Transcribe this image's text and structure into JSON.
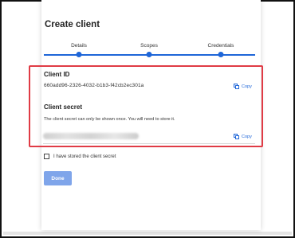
{
  "dialog": {
    "title": "Create client",
    "steps": [
      {
        "label": "Details"
      },
      {
        "label": "Scopes"
      },
      {
        "label": "Credentials"
      }
    ],
    "client_id": {
      "label": "Client ID",
      "value": "660add96-2326-4032-b1b3-f42cb2ec301a",
      "copy_label": "Copy"
    },
    "client_secret": {
      "label": "Client secret",
      "note": "The client secret can only be shown once. You will need to store it.",
      "copy_label": "Copy"
    },
    "stored_checkbox": {
      "label": "I have stored the client secret",
      "checked": false
    },
    "done_label": "Done"
  },
  "colors": {
    "accent": "#1e66d8",
    "highlight_border": "#e03b45",
    "done_button": "#7fa5ea"
  }
}
